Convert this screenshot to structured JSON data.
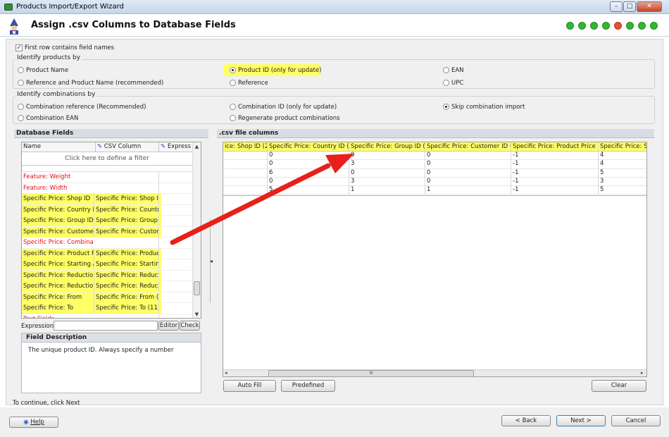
{
  "window": {
    "title": "Products Import/Export Wizard",
    "page_title": "Assign .csv Columns to Database Fields",
    "controls": [
      "–",
      "□",
      "✕"
    ]
  },
  "steps": {
    "colors": [
      "#2fb82f",
      "#2fb82f",
      "#2fb82f",
      "#2fb82f",
      "#e8502c",
      "#2fb82f",
      "#2fb82f",
      "#2fb82f"
    ]
  },
  "options": {
    "first_row_field_names": "First row contains field names",
    "identify_products_label": "Identify products by",
    "product_options": [
      {
        "label": "Product Name",
        "selected": false
      },
      {
        "label": "Product ID (only for update)",
        "selected": true
      },
      {
        "label": "EAN",
        "selected": false
      },
      {
        "label": "Reference and Product Name (recommended)",
        "selected": false
      },
      {
        "label": "Reference",
        "selected": false
      },
      {
        "label": "UPC",
        "selected": false
      }
    ],
    "identify_combinations_label": "Identify combinations by",
    "combination_options": [
      {
        "label": "Combination reference (Recommended)",
        "selected": false
      },
      {
        "label": "Combination ID (only for update)",
        "selected": false
      },
      {
        "label": "Skip combination import",
        "selected": true
      },
      {
        "label": "Combination EAN",
        "selected": false
      },
      {
        "label": "Regenerate product combinations",
        "selected": false
      }
    ]
  },
  "db_fields": {
    "header": "Database Fields",
    "columns": [
      "Name",
      "CSV Column",
      "Express"
    ],
    "filter_hint": "Click here to define a filter",
    "rows": [
      {
        "name": "Feature: Weight",
        "csv": "",
        "red": true,
        "hl": false
      },
      {
        "name": "Feature: Width",
        "csv": "",
        "red": true,
        "hl": false
      },
      {
        "name": "Specific Price: Shop ID",
        "csv": "Specific Price: Shop ID",
        "red": false,
        "hl": true
      },
      {
        "name": "Specific Price: Country ID",
        "csv": "Specific Price: Country",
        "red": false,
        "hl": true
      },
      {
        "name": "Specific Price: Group ID",
        "csv": "Specific Price: Group ID",
        "red": false,
        "hl": true
      },
      {
        "name": "Specific Price: Customer ID",
        "csv": "Specific Price: Custome",
        "red": false,
        "hl": true
      },
      {
        "name": "Specific Price: Combination",
        "csv": "",
        "red": true,
        "hl": false
      },
      {
        "name": "Specific Price: Product Price",
        "csv": "Specific Price: Product",
        "red": false,
        "hl": true
      },
      {
        "name": "Specific Price: Starting At",
        "csv": "Specific Price: Starting",
        "red": false,
        "hl": true
      },
      {
        "name": "Specific Price: Reduction",
        "csv": "Specific Price: Reductio",
        "red": false,
        "hl": true
      },
      {
        "name": "Specific Price: Reduction Type",
        "csv": "Specific Price: Reductio",
        "red": false,
        "hl": true
      },
      {
        "name": "Specific Price: From",
        "csv": "Specific Price: From (10",
        "red": false,
        "hl": true
      },
      {
        "name": "Specific Price: To",
        "csv": "Specific Price: To (11)",
        "red": false,
        "hl": true
      },
      {
        "name": "Text Fields",
        "csv": "",
        "red": true,
        "hl": false
      }
    ],
    "expression_label": "Expression",
    "editor_button": "Editor",
    "check_button": "Check",
    "description_header": "Field Description",
    "description_text": "The unique product ID. Always specify a number"
  },
  "csv": {
    "header": ".csv file columns",
    "columns": [
      "ice: Shop ID (2)",
      "Specific Price: Country ID (3)",
      "Specific Price: Group ID (4)",
      "Specific Price: Customer ID (5)",
      "Specific Price: Product Price (6)",
      "Specific Price: Sta"
    ],
    "rows": [
      [
        "",
        "0",
        "0",
        "0",
        "-1",
        "4"
      ],
      [
        "",
        "0",
        "3",
        "0",
        "-1",
        "4"
      ],
      [
        "",
        "6",
        "0",
        "0",
        "-1",
        "5"
      ],
      [
        "",
        "0",
        "3",
        "0",
        "-1",
        "3"
      ],
      [
        "",
        "5",
        "1",
        "1",
        "-1",
        "5"
      ]
    ],
    "scroll_thumb": "III",
    "auto_fill": "Auto Fill",
    "predefined": "Predefined",
    "clear": "Clear"
  },
  "status": "To continue, click Next",
  "footer": {
    "help": "Help",
    "back": "< Back",
    "next": "Next >",
    "cancel": "Cancel"
  },
  "accent": {
    "highlight": "#ffff66",
    "arrow": "#e8201a",
    "unmapped_text": "#e0101a"
  }
}
